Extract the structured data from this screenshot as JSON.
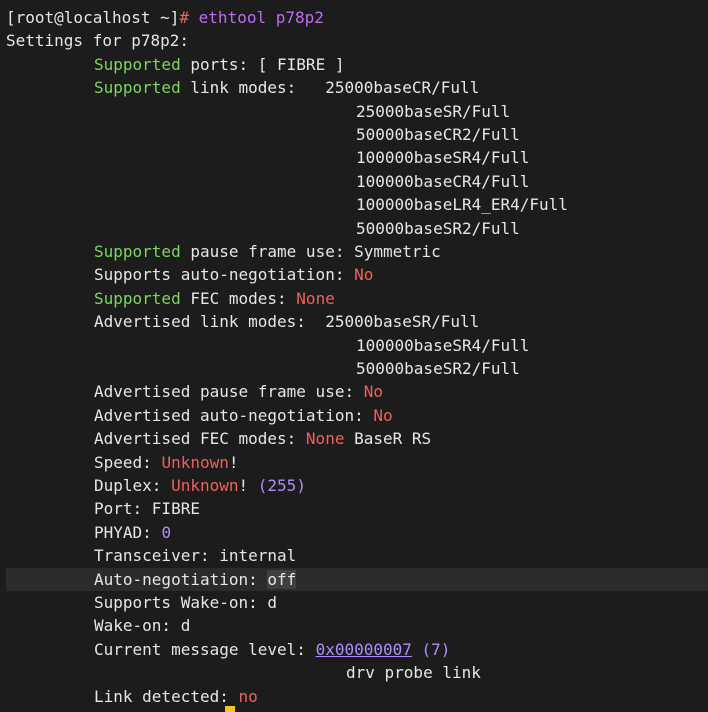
{
  "terminal": {
    "prompt": "[root@localhost ~]",
    "prompt_hash": "#",
    "command": " ethtool p78p2",
    "settings_for": "Settings for p78p2:",
    "supported_word": "Supported",
    "ports_rest": " ports: [ FIBRE ]",
    "link_modes_rest": " link modes:   25000baseCR/Full",
    "supported_modes_cont": [
      "25000baseSR/Full",
      "50000baseCR2/Full",
      "100000baseSR4/Full",
      "100000baseCR4/Full",
      "100000baseLR4_ER4/Full",
      "50000baseSR2/Full"
    ],
    "pause_rest": " pause frame use: Symmetric",
    "autoneg_label": "Supports auto-negotiation: ",
    "no": "No",
    "fec_rest": " FEC modes: ",
    "none": "None",
    "adv_link_label": "Advertised link modes:  25000baseSR/Full",
    "adv_modes_cont": [
      "100000baseSR4/Full",
      "50000baseSR2/Full"
    ],
    "adv_pause_label": "Advertised pause frame use: ",
    "adv_autoneg_label": "Advertised auto-negotiation: ",
    "adv_fec_label": "Advertised FEC modes: ",
    "adv_fec_rest": " BaseR RS",
    "speed_label": "Speed: ",
    "unknown": "Unknown",
    "bang": "!",
    "duplex_label": "Duplex: ",
    "duplex_num_open": " (",
    "duplex_num": "255",
    "duplex_num_close": ")",
    "port_line": "Port: FIBRE",
    "phyad_label": "PHYAD: ",
    "phyad_val": "0",
    "transceiver_line": "Transceiver: internal",
    "autoneg2_label": "Auto-negotiation: ",
    "autoneg2_val": "off",
    "wol_supports": "Supports Wake-on: d",
    "wol": "Wake-on: d",
    "msg_level_label": "Current message level: ",
    "msg_level_hex": "0x00000007",
    "msg_level_paren_open": " (",
    "msg_level_dec": "7",
    "msg_level_paren_close": ")",
    "msg_level_flags": "drv probe link",
    "link_label": "Link detected",
    "colon": ": ",
    "link_val": "no"
  },
  "colors": {
    "background": "#1c1c1c",
    "text": "#e6e6e6",
    "green": "#7ad85a",
    "red": "#f0605a",
    "magenta": "#c06cf0",
    "purple": "#b08cff",
    "cursor": "#f5c518"
  }
}
